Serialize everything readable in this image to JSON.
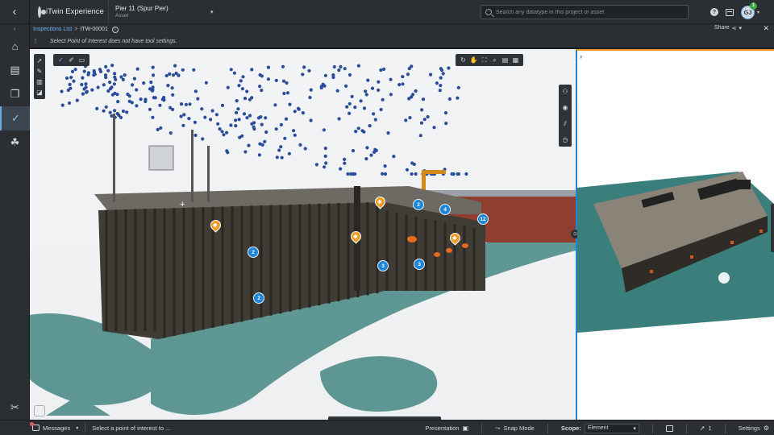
{
  "header": {
    "back_icon": "chevron-left-icon",
    "brand_name": "iTwin Experience",
    "asset_name": "Pier 11 (Spur Pier)",
    "asset_type": "Asset",
    "search_placeholder": "Search any datatype in this project or asset",
    "user_initials": "GJ",
    "notification_count": "1"
  },
  "breadcrumb": {
    "parent": "Inspections List",
    "separator": ">",
    "current": "ITW-00001"
  },
  "share_label": "Share",
  "tool_settings_message": "Select Point of Interest does not have tool settings.",
  "rail": {
    "items": [
      {
        "name": "home-icon",
        "glyph": "⌂"
      },
      {
        "name": "inspection-icon",
        "glyph": "▣"
      },
      {
        "name": "documents-icon",
        "glyph": "❐"
      },
      {
        "name": "checkmark-icon",
        "glyph": "✓"
      },
      {
        "name": "footprints-icon",
        "glyph": "⚲"
      }
    ],
    "tools_icon": "tools-icon"
  },
  "viewport": {
    "markers": [
      {
        "label": "2"
      },
      {
        "label": "4"
      },
      {
        "label": "12"
      },
      {
        "label": "2"
      },
      {
        "label": "3"
      },
      {
        "label": "3"
      },
      {
        "label": "2"
      }
    ],
    "pins": 4
  },
  "footer": {
    "messages_label": "Messages",
    "status_text": "Select a point of interest to ...",
    "presentation_label": "Presentation",
    "snap_mode_label": "Snap Mode",
    "scope_label": "Scope:",
    "scope_value": "Element",
    "selection_count": "1",
    "settings_label": "Settings"
  },
  "colors": {
    "accent": "#1d86d9",
    "pin": "#f39a28",
    "chrome": "#2b2f34",
    "water": "#4e8d88"
  }
}
